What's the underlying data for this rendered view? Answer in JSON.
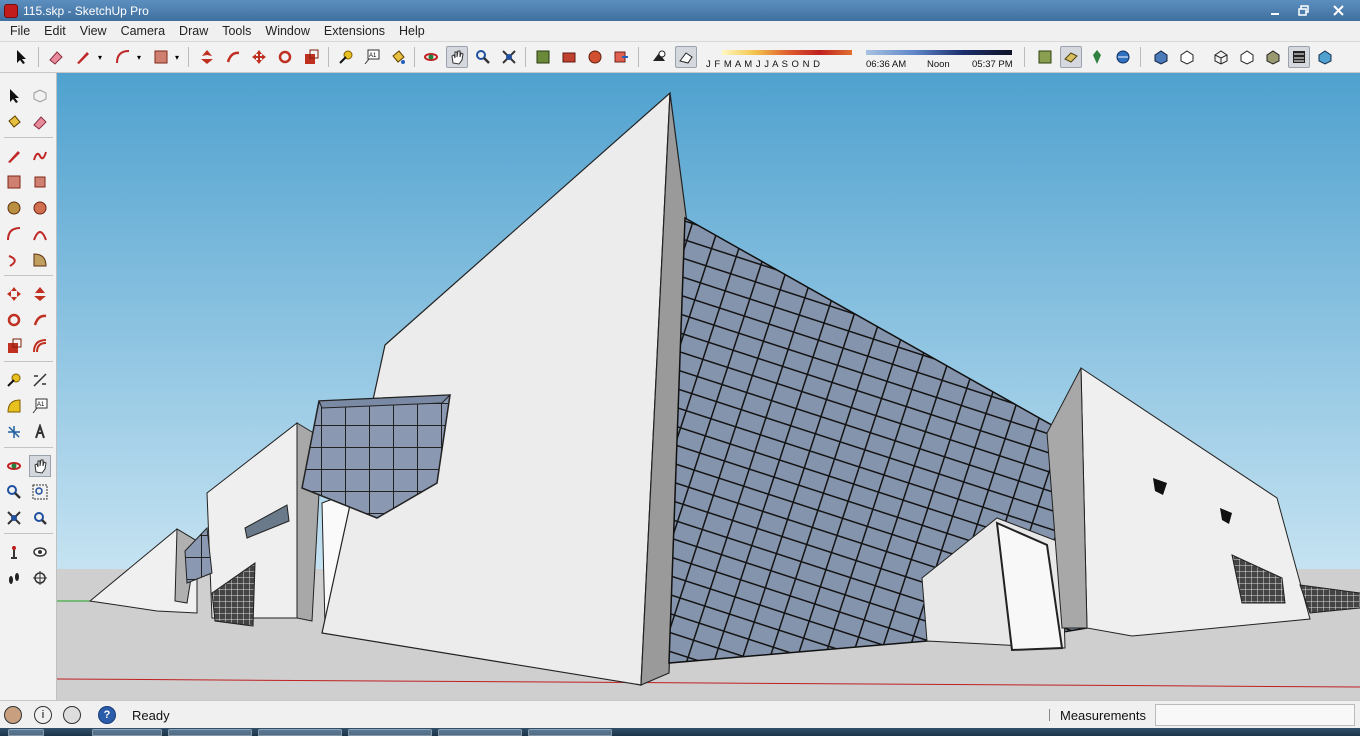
{
  "window": {
    "title": "115.skp - SketchUp Pro",
    "minimize_icon": "minimize-icon",
    "maximize_icon": "restore-icon",
    "close_icon": "close-icon"
  },
  "menu": [
    "File",
    "Edit",
    "View",
    "Camera",
    "Draw",
    "Tools",
    "Window",
    "Extensions",
    "Help"
  ],
  "toolbar": {
    "months_label": "J F M A M J J A S O N D",
    "time_start": "06:36 AM",
    "time_mid": "Noon",
    "time_end": "05:37 PM"
  },
  "status": {
    "text": "Ready",
    "measurements_label": "Measurements",
    "measurements_value": ""
  },
  "colors": {
    "sky_top": "#5aa6d2",
    "sky_bottom": "#bfdff0",
    "ground": "#cfcfcf",
    "wall_light": "#efefef",
    "wall_shadow": "#a8a8a8",
    "glass": "#8090a8",
    "titlebar": "#4a7fb0"
  }
}
